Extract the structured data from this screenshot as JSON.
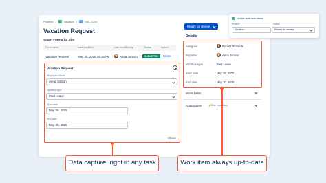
{
  "breadcrumbs": [
    "Projects",
    "Vacation",
    "VAC-1234"
  ],
  "page_title": "Vacation Request",
  "section_title": "Smart Forms for Jira",
  "table": {
    "headers": [
      "Form name",
      "Last modified",
      "Last modified by",
      "Status",
      "Action"
    ],
    "row": {
      "form_name": "Vacation Request",
      "last_modified": "May 26, 2025 09:15 AM",
      "modified_by": "Anna Jonson",
      "status": "SUBMITTED",
      "action": "Close"
    }
  },
  "form": {
    "title": "Vacation Request",
    "fields": [
      {
        "label": "Employee Name",
        "value": "Anna Jonson"
      },
      {
        "label": "Vacation type",
        "value": "Paid Leave"
      },
      {
        "label": "Start date",
        "value": "May 26, 2025"
      },
      {
        "label": "End date",
        "value": "May 30, 2025"
      }
    ],
    "close_label": "Close"
  },
  "status_button": "Ready for review",
  "details": {
    "heading": "Details",
    "rows": [
      {
        "label": "Assignee",
        "value": "Ronald Richards"
      },
      {
        "label": "Reporter",
        "value": "Anna Jonson"
      },
      {
        "label": "Vacation type",
        "value": "Paid Leave"
      },
      {
        "label": "Start date",
        "value": "May 26, 2025"
      },
      {
        "label": "End date",
        "value": "May 30, 2025"
      }
    ],
    "more_fields": "More fields",
    "automation": "Automation",
    "automation_sub": "Rule executions"
  },
  "popup": {
    "title": "Update work item status",
    "project_label": "Project*",
    "project_value": "Vacation",
    "status_label": "Status",
    "status_value": "Ready for review"
  },
  "callouts": {
    "left": "Data capture, right in any task",
    "right": "Work item always up-to-date"
  },
  "colors": {
    "accent": "#ff5630",
    "primary": "#0052cc",
    "success": "#00875a",
    "background": "#e9f0f7"
  }
}
